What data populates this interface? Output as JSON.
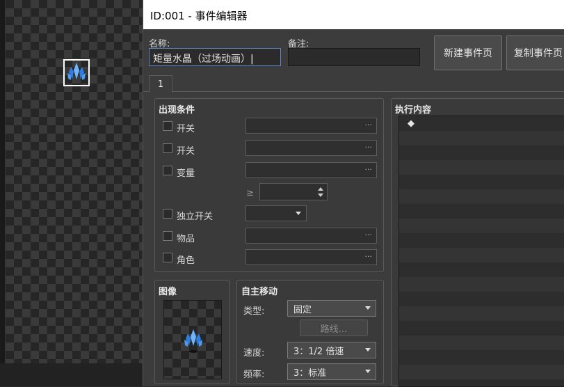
{
  "window": {
    "title": "ID:001 - 事件编辑器"
  },
  "name_label": "名称:",
  "name_value": "矩量水晶（过场动画）",
  "note_label": "备注:",
  "note_value": "",
  "buttons": {
    "new_page": "新建事件页",
    "copy_page": "复制事件页"
  },
  "page_tab": "1",
  "conditions": {
    "title": "出现条件",
    "items": [
      "开关",
      "开关",
      "变量",
      "独立开关",
      "物品",
      "角色"
    ],
    "gte_symbol": "≥",
    "dots": "···"
  },
  "image_panel": {
    "title": "图像"
  },
  "autonomous": {
    "title": "自主移动",
    "type_label": "类型:",
    "type_value": "固定",
    "route_button": "路线...",
    "speed_label": "速度:",
    "speed_value": "3：1/2 倍速",
    "freq_label": "频率:",
    "freq_value": "3：标准"
  },
  "contents": {
    "title": "执行内容",
    "first_line": "◆"
  },
  "colors": {
    "crystal": "#3b8fe8",
    "accent": "#4a7fc0"
  }
}
